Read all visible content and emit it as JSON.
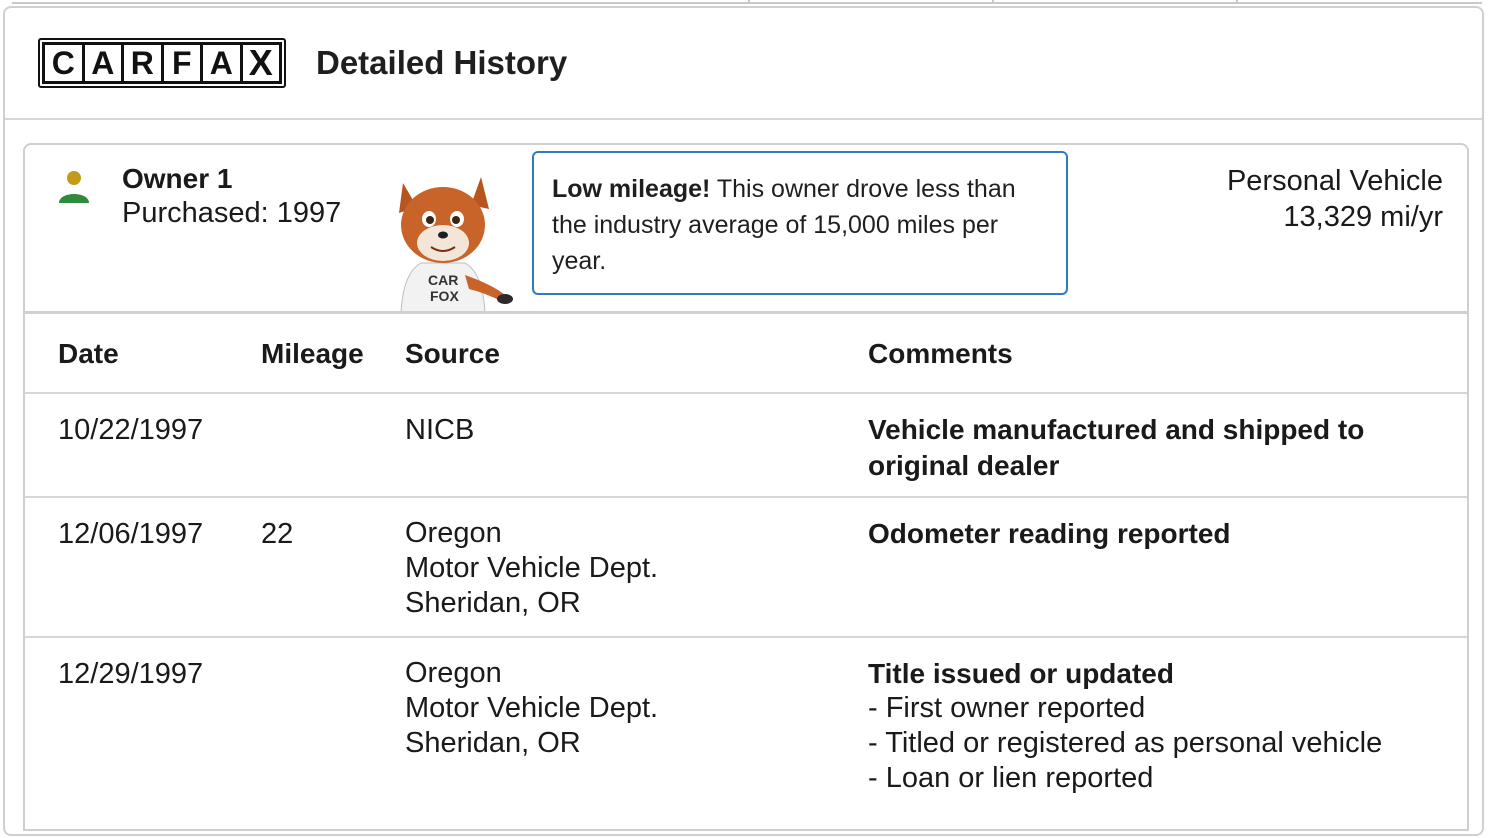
{
  "header": {
    "logo_letters": [
      "C",
      "A",
      "R",
      "F",
      "A",
      "X"
    ],
    "title": "Detailed History"
  },
  "owner": {
    "name": "Owner 1",
    "purchased": "Purchased: 1997",
    "callout_bold": "Low mileage!",
    "callout_text": " This owner drove less than the industry average of 15,000 miles per year.",
    "vehicle_type": "Personal Vehicle",
    "mileage_rate": "13,329 mi/yr",
    "mascot_shirt": [
      "CAR",
      "FOX"
    ]
  },
  "table": {
    "headers": {
      "date": "Date",
      "mileage": "Mileage",
      "source": "Source",
      "comments": "Comments"
    },
    "rows": [
      {
        "date": "10/22/1997",
        "mileage": "",
        "source": [
          "NICB"
        ],
        "comment_title": "Vehicle manufactured and shipped to original dealer",
        "comment_items": []
      },
      {
        "date": "12/06/1997",
        "mileage": "22",
        "source": [
          "Oregon",
          "Motor Vehicle Dept.",
          "Sheridan, OR"
        ],
        "comment_title": "Odometer reading reported",
        "comment_items": []
      },
      {
        "date": "12/29/1997",
        "mileage": "",
        "source": [
          "Oregon",
          "Motor Vehicle Dept.",
          "Sheridan, OR"
        ],
        "comment_title": "Title issued or updated",
        "comment_items": [
          "- First owner reported",
          "- Titled or registered as personal vehicle",
          "- Loan or lien reported"
        ]
      }
    ]
  },
  "colors": {
    "callout_border": "#2e7bc4",
    "person_head": "#c49a1a",
    "person_body": "#2e8b3c"
  }
}
